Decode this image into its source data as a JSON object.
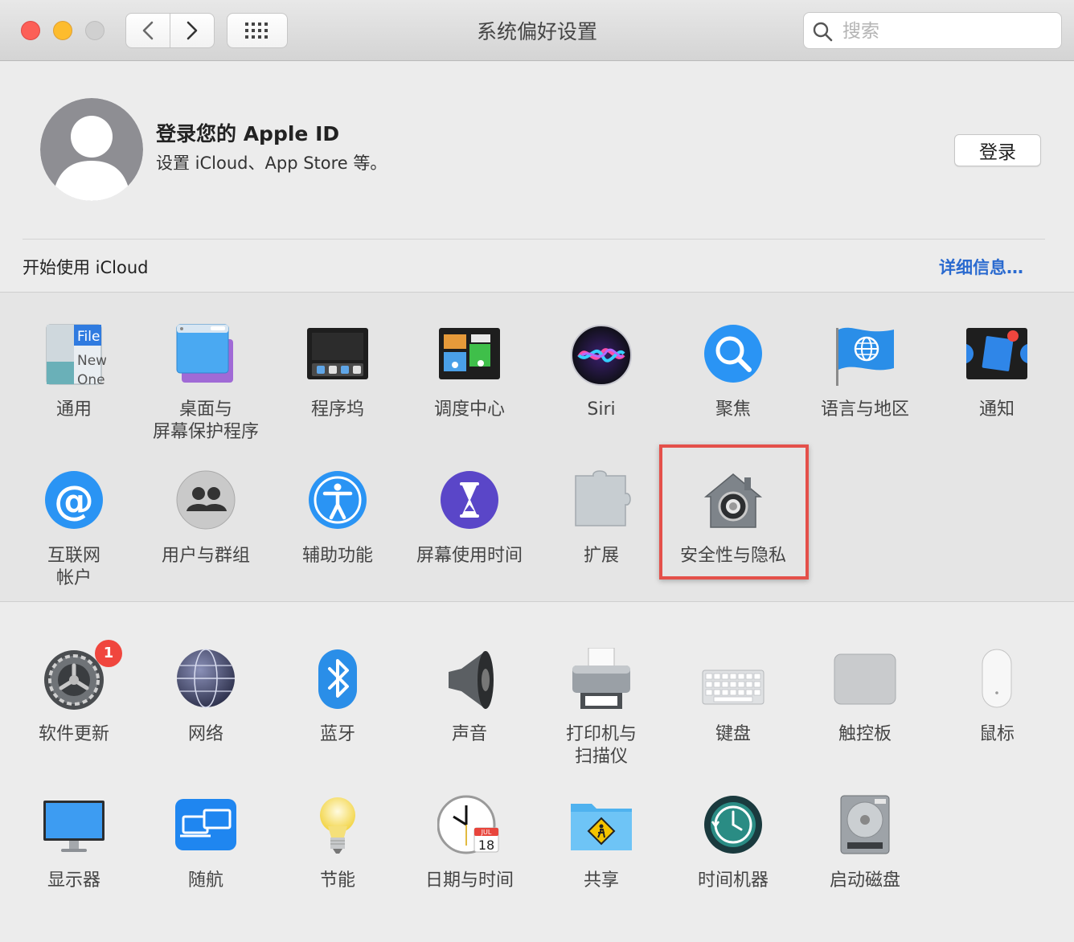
{
  "window": {
    "title": "系统偏好设置"
  },
  "search": {
    "placeholder": "搜索"
  },
  "account": {
    "title": "登录您的 Apple ID",
    "subtitle": "设置 iCloud、App Store 等。",
    "login_label": "登录",
    "icloud_text": "开始使用 iCloud",
    "details_label": "详细信息…"
  },
  "panes_row1": [
    {
      "id": "general",
      "label": "通用",
      "icon": "general-icon"
    },
    {
      "id": "desktop",
      "label": "桌面与\n屏幕保护程序",
      "icon": "desktop-icon"
    },
    {
      "id": "dock",
      "label": "程序坞",
      "icon": "dock-icon"
    },
    {
      "id": "mission",
      "label": "调度中心",
      "icon": "mission-control-icon"
    },
    {
      "id": "siri",
      "label": "Siri",
      "icon": "siri-icon"
    },
    {
      "id": "spotlight",
      "label": "聚焦",
      "icon": "spotlight-icon"
    },
    {
      "id": "language",
      "label": "语言与地区",
      "icon": "language-flag-icon"
    },
    {
      "id": "notifications",
      "label": "通知",
      "icon": "notifications-icon"
    }
  ],
  "panes_row2": [
    {
      "id": "internet",
      "label": "互联网\n帐户",
      "icon": "internet-accounts-icon"
    },
    {
      "id": "users",
      "label": "用户与群组",
      "icon": "users-icon"
    },
    {
      "id": "accessibility",
      "label": "辅助功能",
      "icon": "accessibility-icon"
    },
    {
      "id": "screentime",
      "label": "屏幕使用时间",
      "icon": "hourglass-icon"
    },
    {
      "id": "extensions",
      "label": "扩展",
      "icon": "puzzle-icon"
    },
    {
      "id": "security",
      "label": "安全性与隐私",
      "icon": "security-house-icon"
    }
  ],
  "panes_row3": [
    {
      "id": "update",
      "label": "软件更新",
      "icon": "gear-icon",
      "badge": "1"
    },
    {
      "id": "network",
      "label": "网络",
      "icon": "globe-icon"
    },
    {
      "id": "bluetooth",
      "label": "蓝牙",
      "icon": "bluetooth-icon"
    },
    {
      "id": "sound",
      "label": "声音",
      "icon": "speaker-icon"
    },
    {
      "id": "printers",
      "label": "打印机与\n扫描仪",
      "icon": "printer-icon"
    },
    {
      "id": "keyboard",
      "label": "键盘",
      "icon": "keyboard-icon"
    },
    {
      "id": "trackpad",
      "label": "触控板",
      "icon": "trackpad-icon"
    },
    {
      "id": "mouse",
      "label": "鼠标",
      "icon": "mouse-icon"
    }
  ],
  "panes_row4": [
    {
      "id": "displays",
      "label": "显示器",
      "icon": "monitor-icon"
    },
    {
      "id": "sidecar",
      "label": "随航",
      "icon": "sidecar-icon"
    },
    {
      "id": "energy",
      "label": "节能",
      "icon": "lightbulb-icon"
    },
    {
      "id": "datetime",
      "label": "日期与时间",
      "icon": "clock-icon"
    },
    {
      "id": "sharing",
      "label": "共享",
      "icon": "sharing-folder-icon"
    },
    {
      "id": "timemachine",
      "label": "时间机器",
      "icon": "time-machine-icon"
    },
    {
      "id": "startup",
      "label": "启动磁盘",
      "icon": "hard-disk-icon"
    }
  ],
  "icon_texts": {
    "general_file": "File",
    "general_new": "New",
    "general_one": "One",
    "clock_month": "JUL",
    "clock_day": "18"
  },
  "colors": {
    "accent": "#2a6acf",
    "highlight": "#e4504a"
  }
}
